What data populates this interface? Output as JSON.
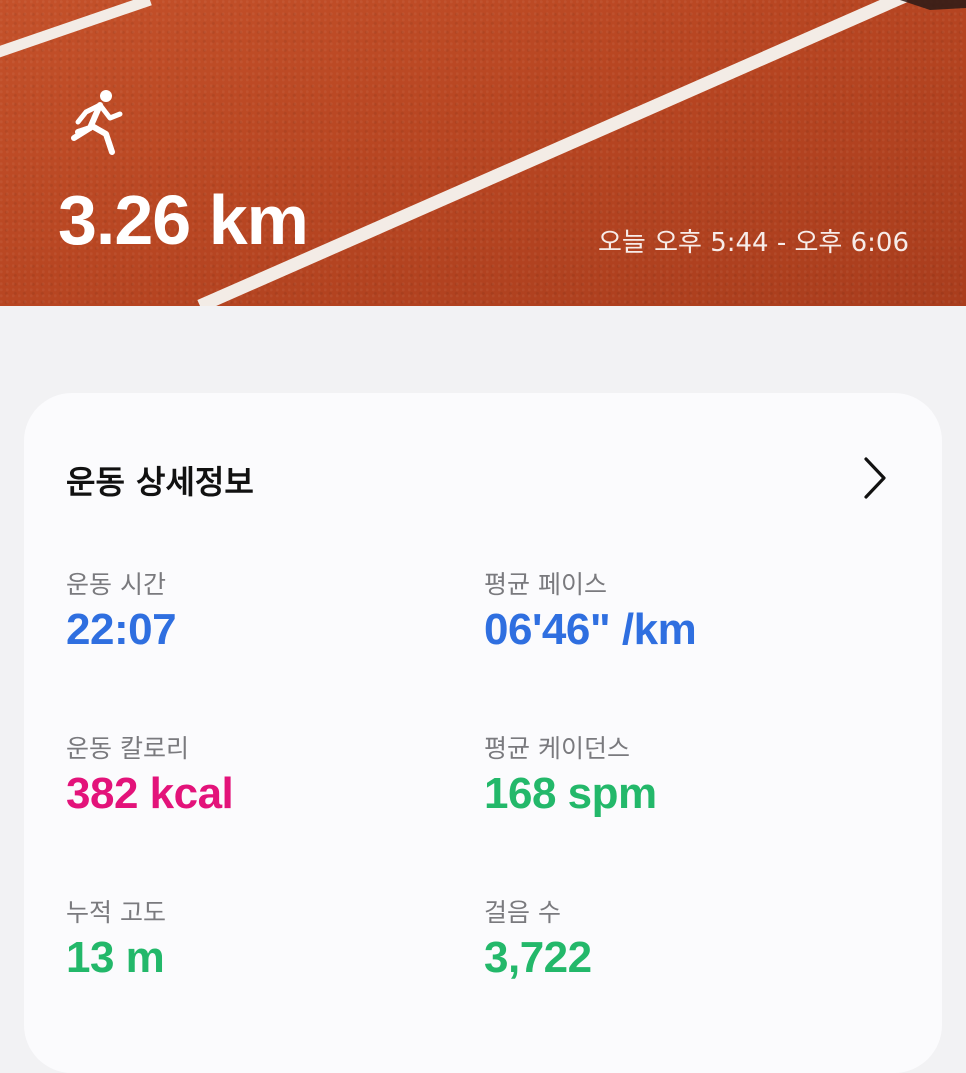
{
  "header": {
    "activity_icon": "running-person-icon",
    "distance": "3.26 km",
    "time_range": "오늘 오후 5:44 - 오후 6:06",
    "background_color": "#b84622"
  },
  "details": {
    "title": "운동 상세정보",
    "more_icon": "chevron-right-icon",
    "stats": [
      {
        "label": "운동 시간",
        "value": "22:07",
        "color": "#2f6fe0"
      },
      {
        "label": "평균 페이스",
        "value": "06'46\" /km",
        "color": "#2f6fe0"
      },
      {
        "label": "운동 칼로리",
        "value": "382 kcal",
        "color": "#e3137a"
      },
      {
        "label": "평균 케이던스",
        "value": "168 spm",
        "color": "#23b86a"
      },
      {
        "label": "누적 고도",
        "value": "13 m",
        "color": "#23b86a"
      },
      {
        "label": "걸음 수",
        "value": "3,722",
        "color": "#23b86a"
      }
    ]
  }
}
